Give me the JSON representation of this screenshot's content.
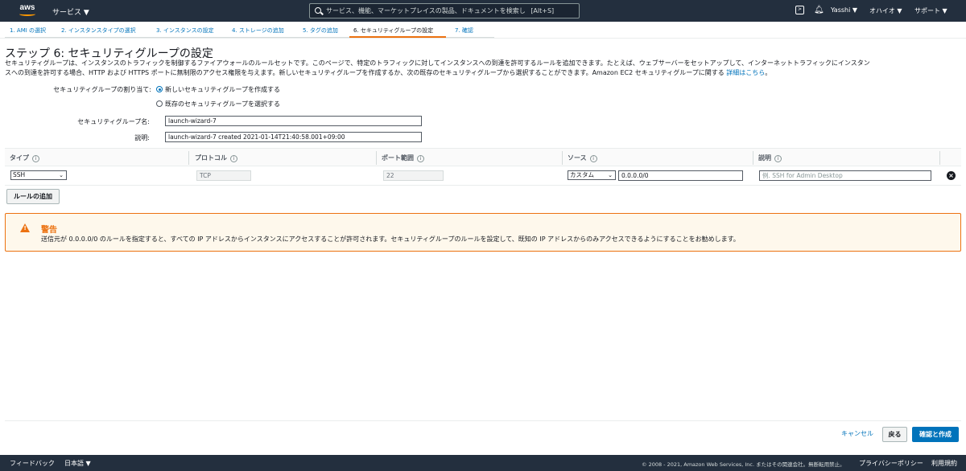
{
  "topbar": {
    "logo_text": "aws",
    "services_label": "サービス ▼",
    "search_placeholder": "サービス、機能、マーケットプレイスの製品、ドキュメントを検索し",
    "search_shortcut": "[Alt+S]",
    "user_label": "Yasshi ▼",
    "region_label": "オハイオ ▼",
    "support_label": "サポート ▼",
    "cloudshell_icon": "terminal-icon",
    "bell_icon": "bell-icon"
  },
  "steps": [
    {
      "label": "1. AMI の選択"
    },
    {
      "label": "2. インスタンスタイプの選択"
    },
    {
      "label": "3. インスタンスの設定"
    },
    {
      "label": "4. ストレージの追加"
    },
    {
      "label": "5. タグの追加"
    },
    {
      "label": "6. セキュリティグループの設定"
    },
    {
      "label": "7. 確認"
    }
  ],
  "page": {
    "title": "ステップ 6: セキュリティグループの設定",
    "description_line1": "セキュリティグループは、インスタンスのトラフィックを制御するファイアウォールのルールセットです。このページで、特定のトラフィックに対してインスタンスへの到達を許可するルールを追加できます。たとえば、ウェブサーバーをセットアップして、インターネットトラフィックにインスタン",
    "description_line2": "スへの到達を許可する場合、HTTP および HTTPS ポートに無制限のアクセス権限を与えます。新しいセキュリティグループを作成するか、次の既存のセキュリティグループから選択することができます。Amazon EC2 セキュリティグループに関する ",
    "description_link": "詳細はこちら",
    "description_end": "。"
  },
  "form": {
    "assign_label": "セキュリティグループの割り当て:",
    "radio_new": "新しいセキュリティグループを作成する",
    "radio_existing": "既存のセキュリティグループを選択する",
    "name_label": "セキュリティグループ名:",
    "name_value": "launch-wizard-7",
    "desc_label": "説明:",
    "desc_value": "launch-wizard-7 created 2021-01-14T21:40:58.001+09:00"
  },
  "table": {
    "headers": [
      "タイプ",
      "プロトコル",
      "ポート範囲",
      "ソース",
      "説明"
    ],
    "info_label": "i",
    "row": {
      "type": "SSH",
      "protocol": "TCP",
      "port": "22",
      "source_type": "カスタム",
      "source_cidr": "0.0.0.0/0",
      "description_placeholder": "例. SSH for Admin Desktop"
    }
  },
  "add_rule_label": "ルールの追加",
  "warning": {
    "title": "警告",
    "text": "送信元が 0.0.0.0/0 のルールを指定すると、すべての IP アドレスからインスタンスにアクセスすることが許可されます。セキュリティグループのルールを設定して、既知の IP アドレスからのみアクセスできるようにすることをお勧めします。"
  },
  "actions": {
    "cancel": "キャンセル",
    "back": "戻る",
    "review": "確認と作成"
  },
  "footer": {
    "feedback": "フィードバック",
    "language": "日本語 ▼",
    "copyright": "© 2008 - 2021, Amazon Web Services, Inc. またはその関連会社。無断転用禁止。",
    "privacy": "プライバシーポリシー",
    "terms": "利用規約"
  },
  "colors": {
    "topbar": "#232f3e",
    "accent": "#ec7211",
    "link": "#0073bb"
  }
}
